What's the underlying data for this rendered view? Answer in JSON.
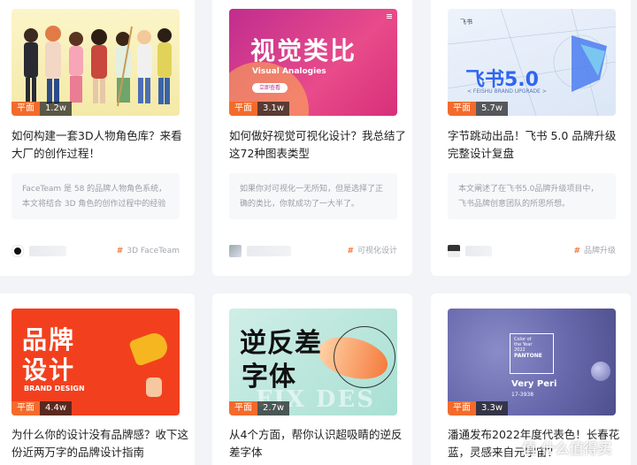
{
  "cards": [
    {
      "category": "平面",
      "views": "1.2w",
      "title": "如何构建一套3D人物角色库？来看大厂的创作过程！",
      "excerpt": "FaceTeam 是 58 的品牌人物角色系统，本文将结合 3D 角色的创作过程中的经验",
      "tag": "3D FaceTeam"
    },
    {
      "category": "平面",
      "views": "3.1w",
      "title": "如何做好视觉可视化设计？我总结了这72种图表类型",
      "excerpt": "如果你对可视化一无所知，但是选择了正确的类比，你就成功了一大半了。",
      "tag": "可视化设计",
      "art": {
        "title": "视觉类比",
        "subtitle": "Visual Analogies",
        "button": "立即查看"
      }
    },
    {
      "category": "平面",
      "views": "5.7w",
      "title": "字节跳动出品！飞书 5.0 品牌升级完整设计复盘",
      "excerpt": "本文阐述了在飞书5.0品牌升级项目中，飞书品牌创意团队的所思所想。",
      "tag": "品牌升级",
      "art": {
        "brand": "飞书",
        "title": "飞书5.0",
        "subtitle": "< FEISHU BRAND UPGRADE >"
      }
    },
    {
      "category": "平面",
      "views": "4.4w",
      "title": "为什么你的设计没有品牌感？收下这份近两万字的品牌设计指南",
      "art": {
        "line1": "品牌",
        "line2": "设计",
        "subtitle": "BRAND DESIGN"
      }
    },
    {
      "category": "平面",
      "views": "2.7w",
      "title": "从4个方面，帮你认识超吸睛的逆反差字体",
      "art": {
        "line1": "逆反差",
        "line2": "字体",
        "bg_text": "FIX DES"
      }
    },
    {
      "category": "平面",
      "views": "3.3w",
      "title": "潘通发布2022年度代表色！长春花蓝，灵感来自元宇宙？",
      "art": {
        "chip_line1": "Color of",
        "chip_line2": "the Year",
        "chip_year": "2022",
        "chip_brand": "PANTONE",
        "color_name": "Very Peri",
        "color_code": "17-3938"
      }
    }
  ],
  "watermark": "值 什么值得买",
  "colors": {
    "badge_orange": "#f36b2c",
    "tag_hash": "#f0793a",
    "very_peri": "#6667ab"
  }
}
